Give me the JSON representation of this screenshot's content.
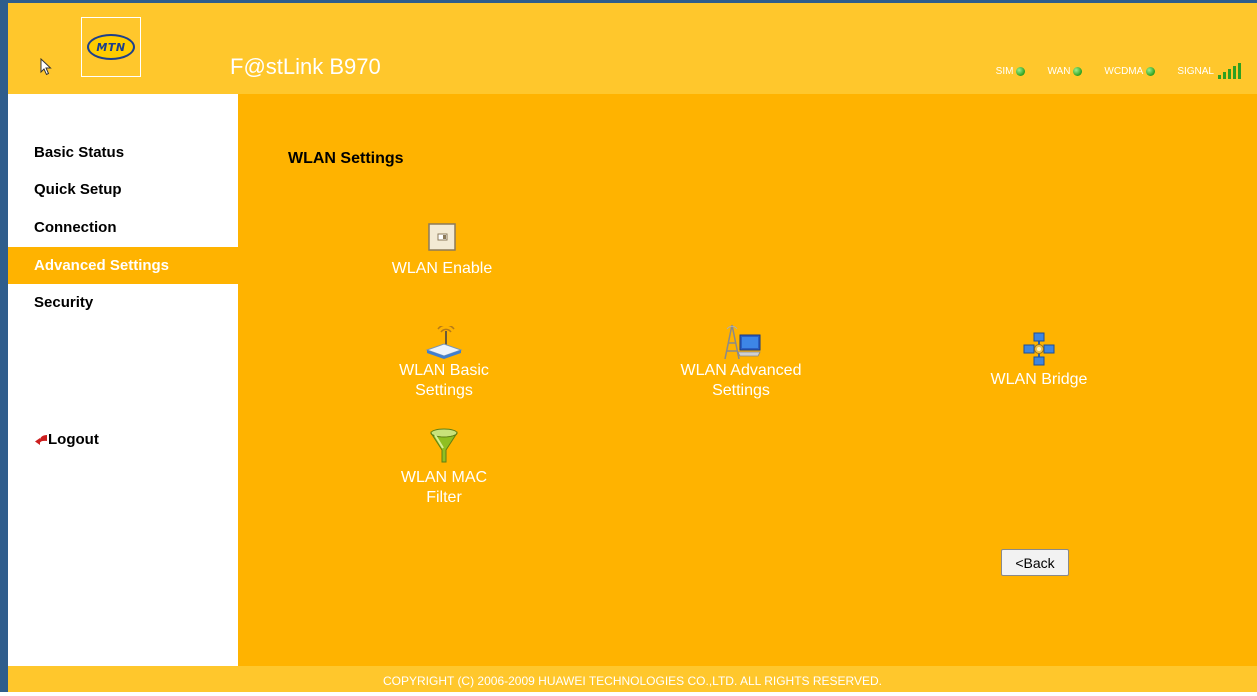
{
  "header": {
    "logo_text": "MTN",
    "product_name": "F@stLink B970",
    "indicators": {
      "sim": "SIM",
      "wan": "WAN",
      "wcdma": "WCDMA",
      "signal": "SIGNAL"
    },
    "signal_bars": 5,
    "colors": {
      "header": "#ffc72c",
      "led_green": "#2ea020"
    }
  },
  "sidebar": {
    "items": [
      {
        "label": "Basic Status"
      },
      {
        "label": "Quick Setup"
      },
      {
        "label": "Connection"
      },
      {
        "label": "Advanced Settings",
        "active": true
      },
      {
        "label": "Security"
      }
    ],
    "logout_label": "Logout"
  },
  "main": {
    "title": "WLAN Settings",
    "tiles": {
      "wlan_enable": {
        "label": "WLAN Enable",
        "icon": "toggle-switch-icon"
      },
      "wlan_basic": {
        "line1": "WLAN Basic",
        "line2": "Settings",
        "icon": "wireless-router-icon"
      },
      "wlan_advanced": {
        "line1": "WLAN Advanced",
        "line2": "Settings",
        "icon": "antenna-computer-icon"
      },
      "wlan_bridge": {
        "label": "WLAN Bridge",
        "icon": "network-bridge-icon"
      },
      "wlan_mac_filter": {
        "line1": "WLAN MAC",
        "line2": "Filter",
        "icon": "funnel-filter-icon"
      }
    },
    "back_label": "<Back",
    "colors": {
      "content": "#ffb300"
    }
  },
  "footer": {
    "copyright": "COPYRIGHT (C) 2006-2009 HUAWEI TECHNOLOGIES CO.,LTD. ALL RIGHTS RESERVED."
  }
}
